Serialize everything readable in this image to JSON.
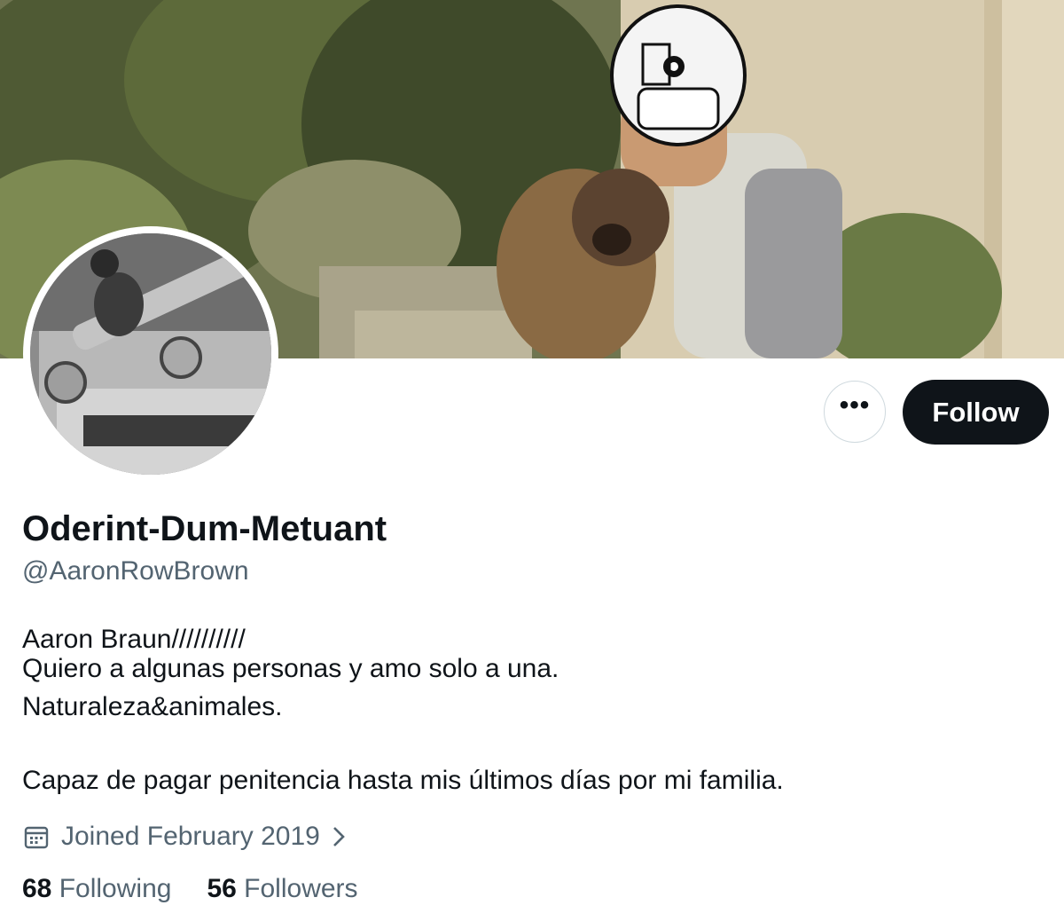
{
  "profile": {
    "display_name": "Oderint-Dum-Metuant",
    "handle": "@AaronRowBrown",
    "bio_lines": [
      "Aaron Braun//////////",
      "Quiero a algunas personas y amo solo a una.",
      "Naturaleza&animales.",
      "Capaz de pagar penitencia hasta mis últimos días por mi familia."
    ],
    "joined": "Joined February 2019",
    "following_count": "68",
    "following_label": "Following",
    "followers_count": "56",
    "followers_label": "Followers"
  },
  "actions": {
    "more_label": "•••",
    "follow_label": "Follow"
  },
  "icons": {
    "more": "more-horizontal-icon",
    "calendar": "calendar-icon",
    "chevron": "chevron-right-icon"
  },
  "colors": {
    "primary_text": "#0f1419",
    "secondary_text": "#536471",
    "follow_bg": "#0f1419",
    "border": "#cfd9de"
  }
}
